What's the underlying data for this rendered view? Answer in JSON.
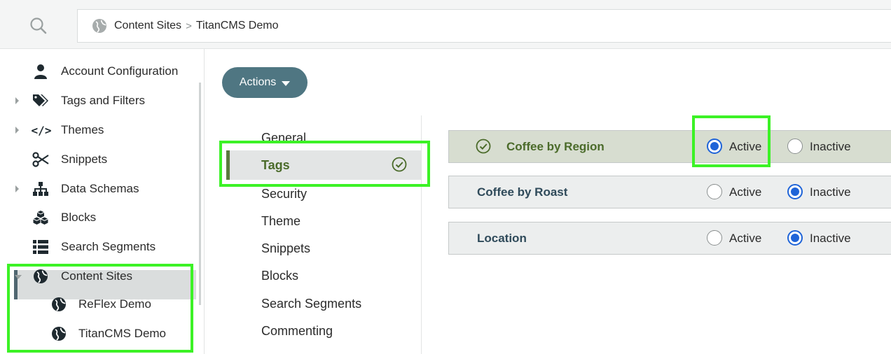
{
  "header": {
    "breadcrumb": [
      "Content Sites",
      "TitanCMS Demo"
    ],
    "separator": ">"
  },
  "sidebar": {
    "items": [
      {
        "label": "Account Configuration",
        "icon": "user-icon",
        "expandable": false
      },
      {
        "label": "Tags and Filters",
        "icon": "tags-icon",
        "expandable": true
      },
      {
        "label": "Themes",
        "icon": "code-icon",
        "expandable": true,
        "icon_text": "</>"
      },
      {
        "label": "Snippets",
        "icon": "scissors-icon",
        "expandable": false
      },
      {
        "label": "Data Schemas",
        "icon": "sitemap-icon",
        "expandable": true
      },
      {
        "label": "Blocks",
        "icon": "cubes-icon",
        "expandable": false
      },
      {
        "label": "Search Segments",
        "icon": "list-icon",
        "expandable": false
      },
      {
        "label": "Content Sites",
        "icon": "globe-icon",
        "expandable": true,
        "expanded": true
      },
      {
        "label": "ReFlex Demo",
        "icon": "globe-icon",
        "child": true
      },
      {
        "label": "TitanCMS Demo",
        "icon": "globe-icon",
        "child": true,
        "selected": true
      }
    ]
  },
  "main": {
    "actions_label": "Actions",
    "subnav": [
      {
        "label": "General"
      },
      {
        "label": "Tags",
        "selected": true,
        "complete": true
      },
      {
        "label": "Security"
      },
      {
        "label": "Theme"
      },
      {
        "label": "Snippets"
      },
      {
        "label": "Blocks"
      },
      {
        "label": "Search Segments"
      },
      {
        "label": "Commenting"
      }
    ],
    "tags": [
      {
        "name": "Coffee by Region",
        "status": "Active",
        "active_label": "Active",
        "inactive_label": "Inactive"
      },
      {
        "name": "Coffee by Roast",
        "status": "Inactive",
        "active_label": "Active",
        "inactive_label": "Inactive"
      },
      {
        "name": "Location",
        "status": "Inactive",
        "active_label": "Active",
        "inactive_label": "Inactive"
      }
    ]
  },
  "colors": {
    "accent_green": "#5a7a3e",
    "actions_button": "#4f7682",
    "radio_selected": "#1f64d8",
    "highlight": "#3cf226"
  }
}
